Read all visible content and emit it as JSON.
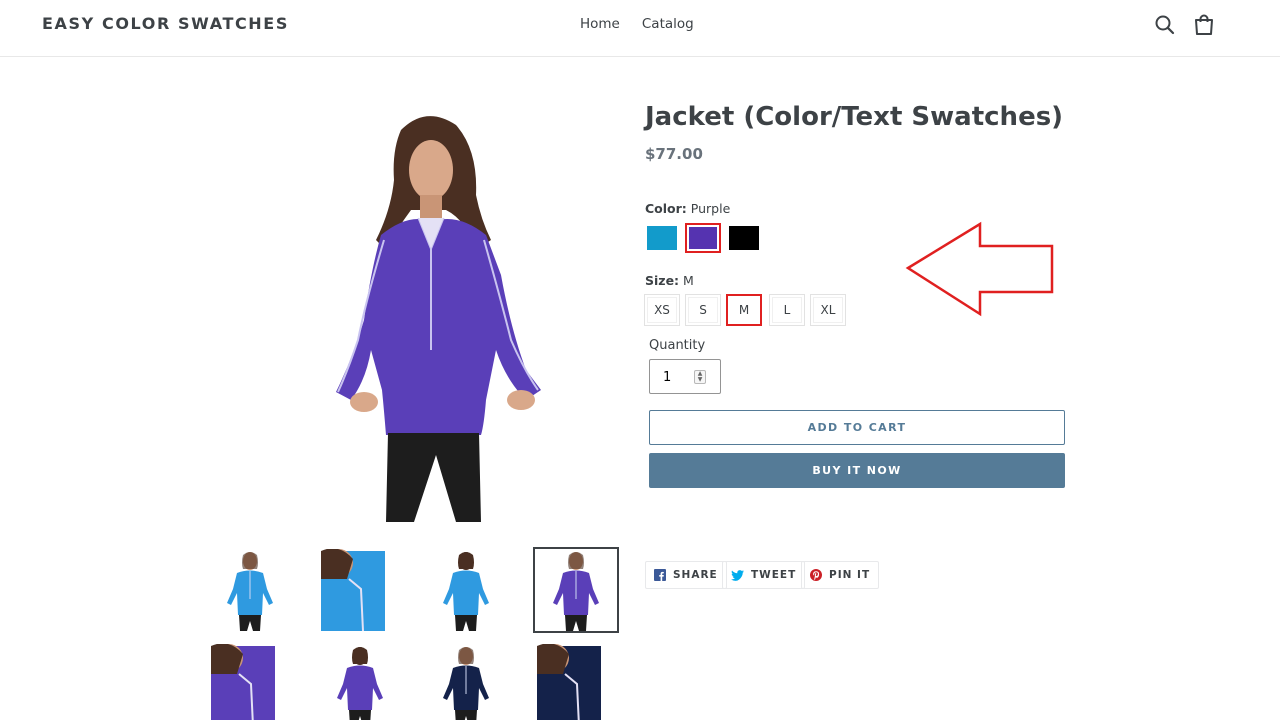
{
  "header": {
    "logo": "EASY COLOR SWATCHES",
    "nav": [
      "Home",
      "Catalog"
    ],
    "icons": [
      "search-icon",
      "cart-icon"
    ]
  },
  "product": {
    "title": "Jacket (Color/Text Swatches)",
    "price": "$77.00",
    "color": {
      "label": "Color:",
      "selected": "Purple",
      "swatches": [
        {
          "name": "Blue",
          "hex": "#129bcb"
        },
        {
          "name": "Purple",
          "hex": "#5533b0"
        },
        {
          "name": "Black",
          "hex": "#000000"
        }
      ]
    },
    "size": {
      "label": "Size:",
      "selected": "M",
      "options": [
        "XS",
        "S",
        "M",
        "L",
        "XL"
      ]
    },
    "quantity": {
      "label": "Quantity",
      "value": "1"
    },
    "add_to_cart": "ADD TO CART",
    "buy_now": "BUY IT NOW"
  },
  "share": [
    {
      "label": "SHARE",
      "icon": "facebook-icon"
    },
    {
      "label": "TWEET",
      "icon": "twitter-icon"
    },
    {
      "label": "PIN IT",
      "icon": "pinterest-icon"
    }
  ],
  "thumbnails": [
    {
      "color": "blue",
      "view": "front",
      "active": false
    },
    {
      "color": "blue",
      "view": "closeup",
      "active": false
    },
    {
      "color": "blue",
      "view": "back",
      "active": false
    },
    {
      "color": "purple",
      "view": "front",
      "active": true
    },
    {
      "color": "purple",
      "view": "closeup",
      "active": false
    },
    {
      "color": "purple",
      "view": "back",
      "active": false
    },
    {
      "color": "navy",
      "view": "front",
      "active": false
    },
    {
      "color": "navy",
      "view": "closeup",
      "active": false
    }
  ],
  "colors": {
    "accent": "#557b97",
    "highlight": "#e02020",
    "text": "#3d4246"
  }
}
